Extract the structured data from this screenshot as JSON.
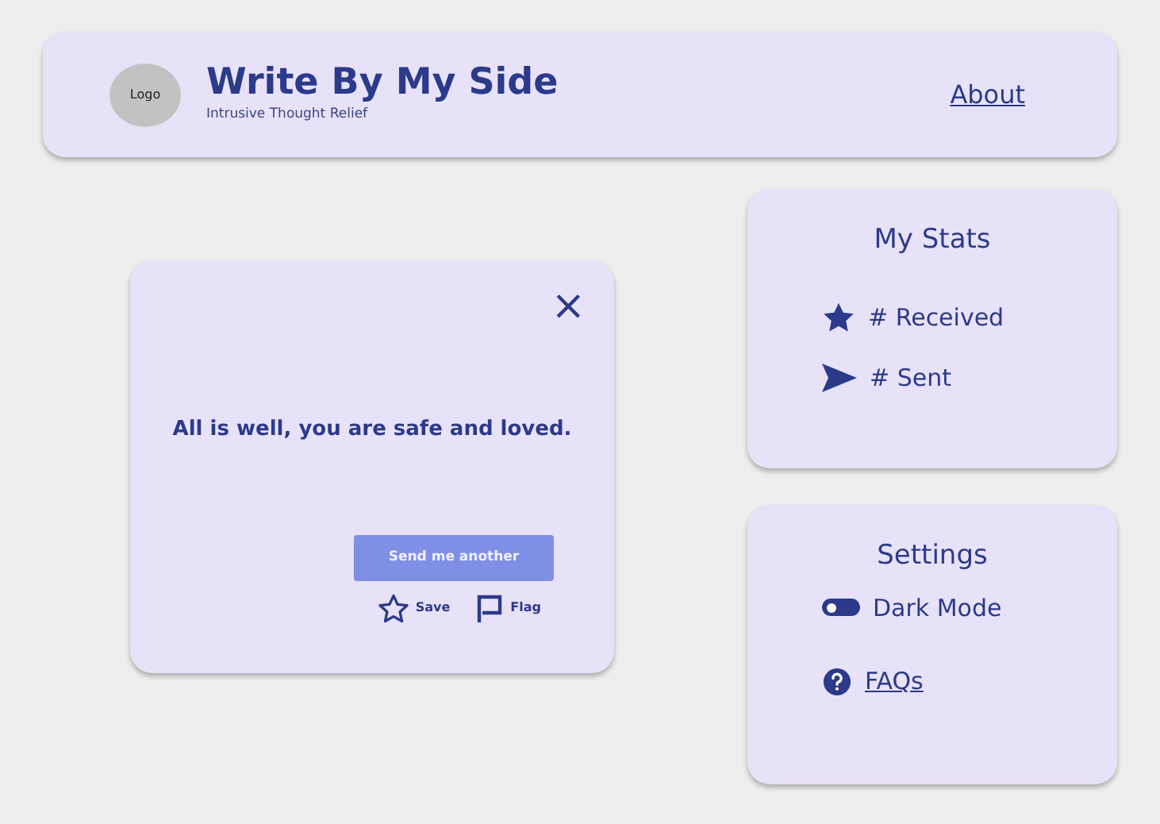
{
  "header": {
    "logo": "Logo",
    "title": "Write By My Side",
    "subtitle": "Intrusive Thought Relief",
    "nav_link": "About"
  },
  "message_card": {
    "close": "×",
    "message": "All is well, you are safe and loved.",
    "button": "Send me another",
    "actions": [
      {
        "kind": "save",
        "label": "Save"
      },
      {
        "kind": "flag",
        "label": "Flag"
      }
    ]
  },
  "stats": {
    "title": "My Stats",
    "items": [
      {
        "kind": "received",
        "label": "# Received"
      },
      {
        "kind": "sent",
        "label": "# Sent"
      }
    ]
  },
  "settings": {
    "title": "Settings",
    "dark_mode": {
      "label": "Dark Mode",
      "on": false
    },
    "faq_link": "FAQs"
  }
}
